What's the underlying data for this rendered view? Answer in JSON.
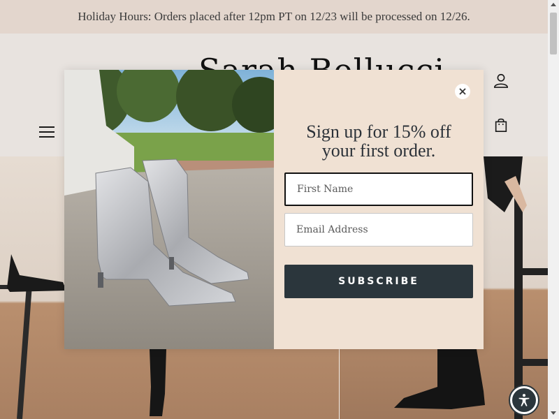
{
  "announcement": {
    "text": "Holiday Hours: Orders placed after 12pm PT on 12/23 will be processed on 12/26."
  },
  "header": {
    "logo_text": "Sarah Bellucci",
    "icons": {
      "menu": "hamburger-menu-icon",
      "account": "user-account-icon",
      "cart": "shopping-bag-icon"
    }
  },
  "popup": {
    "headline": "Sign up for 15% off your first order.",
    "first_name_placeholder": "First Name",
    "email_placeholder": "Email Address",
    "subscribe_label": "SUBSCRIBE",
    "image_alt": "silver metallic western ankle boots",
    "close_icon": "close-x-icon"
  },
  "accessibility": {
    "icon": "accessibility-person-icon"
  },
  "colors": {
    "announcement_bg": "#e3d6cd",
    "page_bg": "#e8e3df",
    "popup_form_bg": "#f0e1d3",
    "button_bg": "#2b363c",
    "text_dark": "#2b3138"
  }
}
